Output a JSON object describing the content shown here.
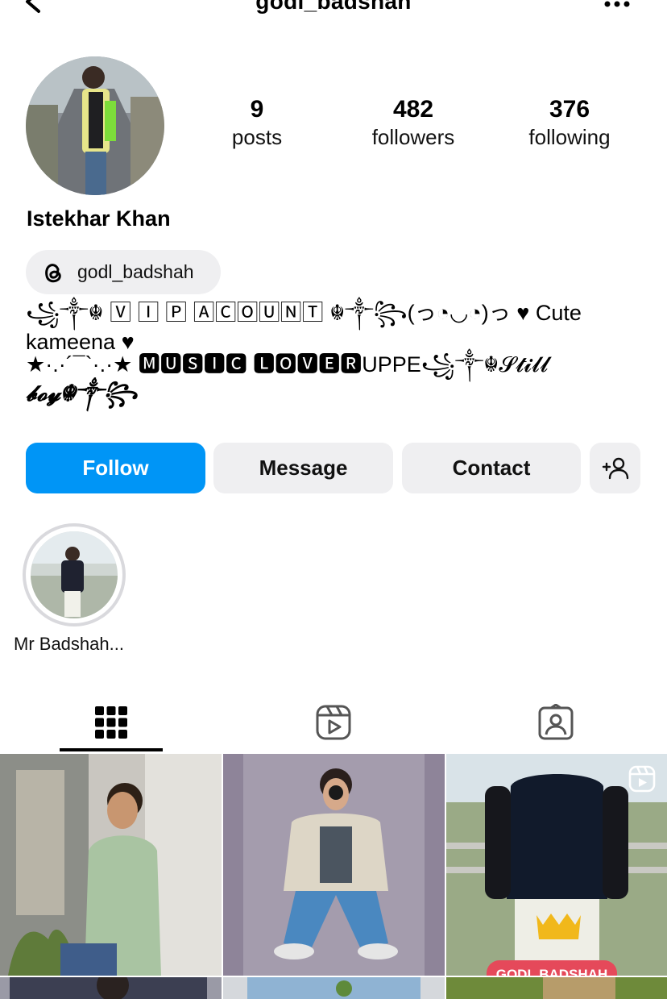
{
  "header": {
    "username": "godl_badshah"
  },
  "profile": {
    "display_name": "Istekhar Khan",
    "stats": [
      {
        "value": "9",
        "label": "posts"
      },
      {
        "value": "482",
        "label": "followers"
      },
      {
        "value": "376",
        "label": "following"
      }
    ],
    "threads_handle": "godl_badshah",
    "bio_lines": [
      "꧁༒☬ 🅅 🄸 🄿 🄰🄲🄾🅄🄽🅃 ☬༒꧂(っ◔◡◔)っ ♥ Cute",
      "kameena ♥",
      "★·.·´¯`·.·★ 🅼🆄🆂🅸🅲 🅻🅾🆅🅴🆁UPPE꧁༒☬𝓢𝓽𝓲𝓵𝓵",
      "𝓫𝓸𝔂☬༒꧂"
    ]
  },
  "actions": {
    "follow": "Follow",
    "message": "Message",
    "contact": "Contact"
  },
  "highlights": [
    {
      "label": "Mr Badshah..."
    }
  ],
  "posts": [
    {
      "type": "photo",
      "caption": ""
    },
    {
      "type": "photo",
      "caption": ""
    },
    {
      "type": "reel",
      "caption": "GODL BADSHAH"
    }
  ],
  "colors": {
    "primary": "#0095f6",
    "chip_bg": "#efeff1",
    "caption_bg": "#e5495a"
  },
  "icons": [
    "back-chevron-icon",
    "more-dots-icon",
    "threads-icon",
    "add-person-icon",
    "grid-icon",
    "reels-icon",
    "tagged-icon",
    "reel-badge-icon"
  ]
}
